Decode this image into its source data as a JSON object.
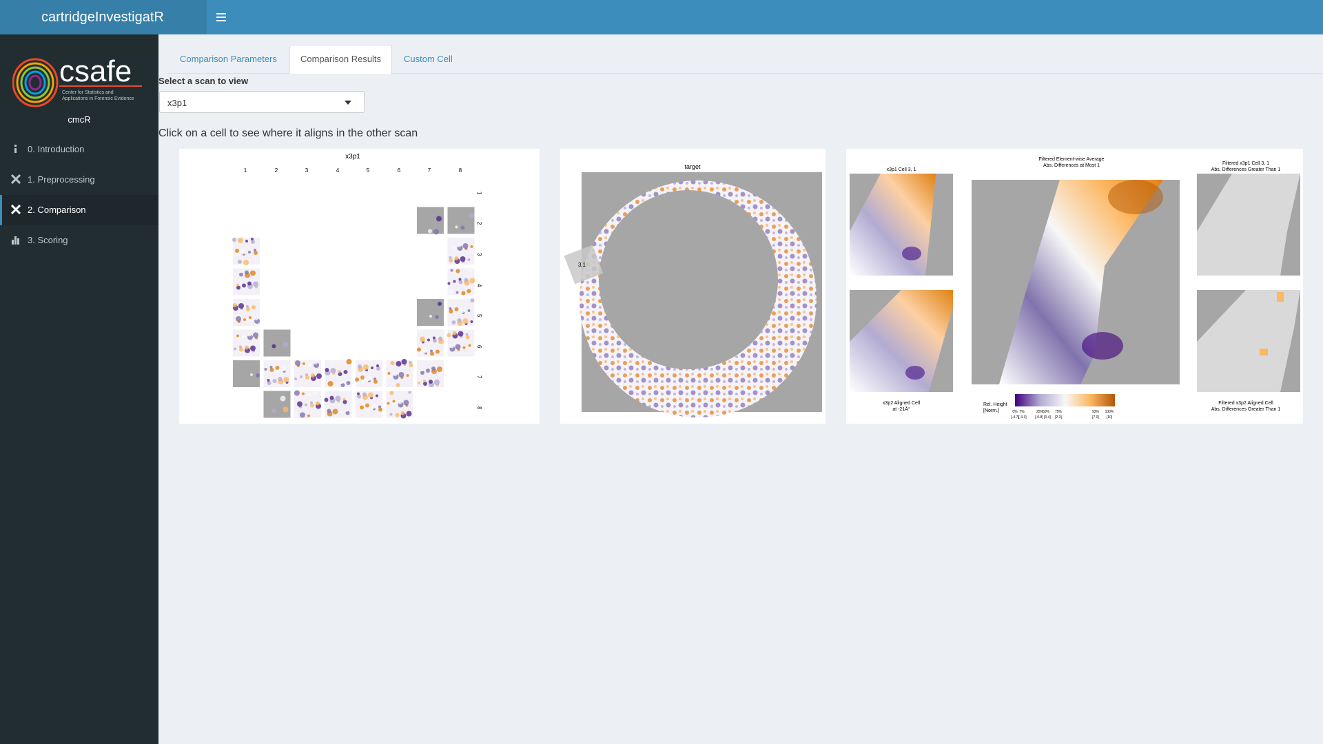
{
  "header": {
    "app_title": "cartridgeInvestigatR",
    "toggle_icon": "hamburger-icon"
  },
  "sidebar": {
    "brand_name": "csafe",
    "brand_tagline_1": "Center for Statistics and",
    "brand_tagline_2": "Applications in Forensic Evidence",
    "subtitle": "cmcR",
    "items": [
      {
        "label": "0. Introduction",
        "icon": "info-icon"
      },
      {
        "label": "1. Preprocessing",
        "icon": "tools-icon"
      },
      {
        "label": "2. Comparison",
        "icon": "tools-icon",
        "active": true
      },
      {
        "label": "3. Scoring",
        "icon": "bar-chart-icon"
      }
    ]
  },
  "tabs": [
    {
      "label": "Comparison Parameters"
    },
    {
      "label": "Comparison Results",
      "active": true
    },
    {
      "label": "Custom Cell"
    }
  ],
  "scan_select": {
    "label": "Select a scan to view",
    "value": "x3p1"
  },
  "instruction": "Click on a cell to see where it aligns in the other scan",
  "grid_plot": {
    "title": "x3p1",
    "col_labels": [
      "1",
      "2",
      "3",
      "4",
      "5",
      "6",
      "7",
      "8"
    ],
    "row_labels": [
      "1",
      "2",
      "3",
      "4",
      "5",
      "6",
      "7",
      "8"
    ]
  },
  "target_plot": {
    "title": "target",
    "cell_marker": "3,1"
  },
  "comparison_plot": {
    "left_top_title": "x3p1 Cell 3, 1",
    "left_bottom_title_1": "x3p2 Aligned Cell",
    "left_bottom_title_2": "at -21Â°",
    "center_title_1": "Filtered Element-wise Average",
    "center_title_2": "Abs. Differences at Most 1",
    "right_top_title_1": "Filtered x3p1 Cell 3, 1",
    "right_top_title_2": "Abs. Differences Greater Than 1",
    "right_bottom_title_1": "Filtered x3p2 Aligned Cell",
    "right_bottom_title_2": "Abs. Differences Greater Than 1",
    "legend_title_1": "Rel. Height",
    "legend_title_2": "[Norm.]",
    "legend_pct": [
      "0%",
      "7%",
      "25%",
      "50%",
      "75%",
      "93%",
      "100%"
    ],
    "legend_vals": [
      "[-4.7]",
      "[-3.3]",
      "[-0.8]",
      "[0.4]",
      "[2.3]",
      "[7.0]",
      "[10]"
    ]
  }
}
